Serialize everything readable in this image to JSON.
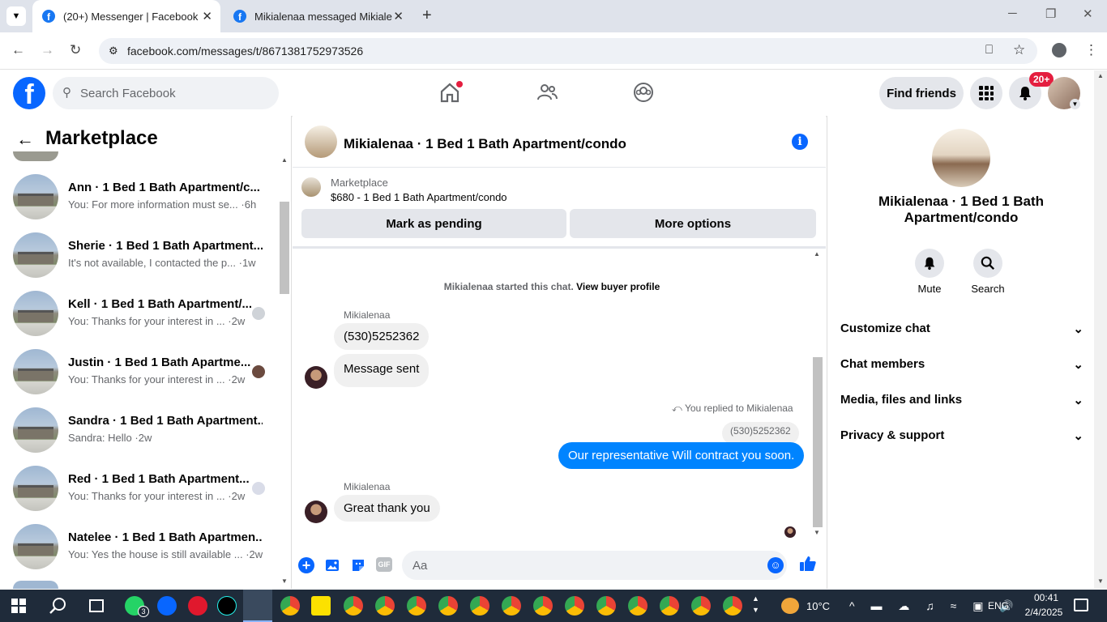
{
  "browser": {
    "tabs": [
      {
        "title": "(20+) Messenger | Facebook"
      },
      {
        "title": "Mikialenaa messaged Mikialena"
      }
    ],
    "url": "facebook.com/messages/t/8671381752973526"
  },
  "fb": {
    "search_placeholder": "Search Facebook",
    "find_friends": "Find friends",
    "notif_badge": "20+"
  },
  "sidebar": {
    "title": "Marketplace",
    "conversations": [
      {
        "name": "Ann · 1 Bed 1 Bath Apartment/c...",
        "preview": "You: For more information must se... ·6h"
      },
      {
        "name": "Sherie · 1 Bed 1 Bath Apartment...",
        "preview": "It's not available, I contacted the p... ·1w"
      },
      {
        "name": "Kell · 1 Bed 1 Bath Apartment/...",
        "preview": "You: Thanks for your interest in ... ·2w"
      },
      {
        "name": "Justin · 1 Bed 1 Bath Apartme...",
        "preview": "You: Thanks for your interest in ... ·2w"
      },
      {
        "name": "Sandra · 1 Bed 1 Bath Apartment...",
        "preview": "Sandra: Hello ·2w"
      },
      {
        "name": "Red · 1 Bed 1 Bath Apartment...",
        "preview": "You: Thanks for your interest in ... ·2w"
      },
      {
        "name": "Natelee · 1 Bed 1 Bath Apartmen...",
        "preview": "You: Yes the house is still available ... ·2w"
      }
    ]
  },
  "chat": {
    "title": "Mikialenaa · 1 Bed 1 Bath Apartment/condo",
    "listing_label": "Marketplace",
    "listing_price": "$680 - 1 Bed 1 Bath Apartment/condo",
    "mark_pending": "Mark as pending",
    "more_options": "More options",
    "started_text": "Mikialenaa started this chat.",
    "view_buyer": "View buyer profile",
    "sender1": "Mikialenaa",
    "msg1": "(530)5252362",
    "msg2": "Message sent",
    "replied_to": "You replied to Mikialenaa",
    "quoted": "(530)5252362",
    "msg_out": "Our representative Will contract you soon.",
    "sender2": "Mikialenaa",
    "msg3": "Great thank you",
    "composer_placeholder": "Aa"
  },
  "details": {
    "name": "Mikialenaa · 1 Bed 1 Bath Apartment/condo",
    "mute": "Mute",
    "search": "Search",
    "sections": [
      "Customize chat",
      "Chat members",
      "Media, files and links",
      "Privacy & support"
    ]
  },
  "taskbar": {
    "weather": "10°C",
    "lang": "ENG",
    "time": "00:41",
    "date": "2/4/2025",
    "whatsapp_badge": "3"
  },
  "colors": {
    "fb_blue": "#0866ff",
    "messenger_blue": "#0084ff",
    "badge_red": "#e41e3f"
  }
}
